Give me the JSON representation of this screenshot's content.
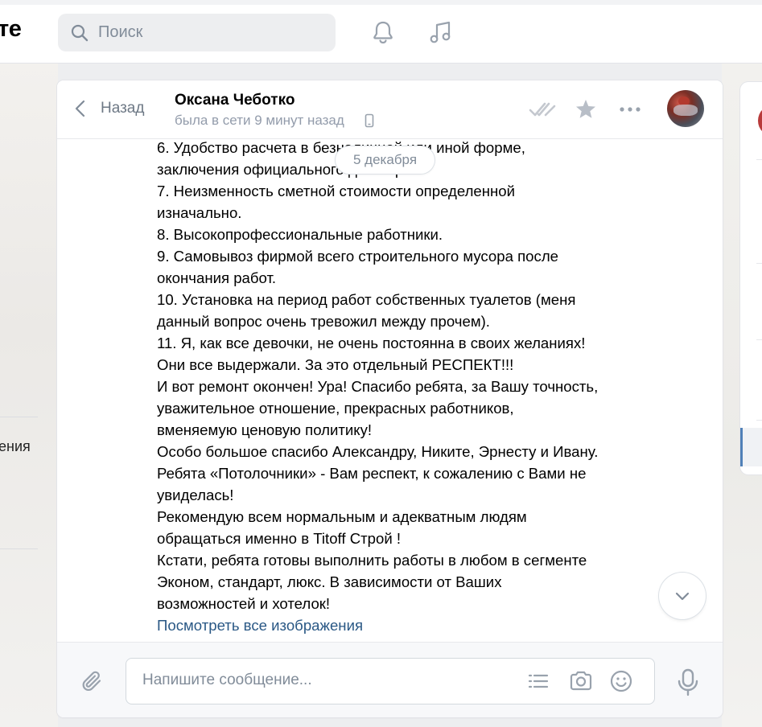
{
  "top": {
    "logo_fragment": "те",
    "search_placeholder": "Поиск"
  },
  "left": {
    "fragment": "ения"
  },
  "header": {
    "back_label": "Назад",
    "peer_name": "Оксана Чеботко",
    "peer_status": "была в сети 9 минут назад"
  },
  "date_pill": "5 декабря",
  "message": {
    "lines": [
      "6. Удобство расчета в безналичной или иной форме,",
      "заключения официального договора.",
      "7. Неизменность сметной стоимости определенной",
      "изначально.",
      "8. Высокопрофессиональные работники.",
      "9. Самовывоз фирмой всего строительного мусора после",
      "окончания работ.",
      "10. Установка на период работ собственных туалетов (меня",
      "данный вопрос очень тревожил между прочем).",
      "11. Я, как все девочки, не очень постоянна в своих желаниях!",
      "Они все выдержали. За это отдельный РЕСПЕКТ!!!",
      "И вот ремонт окончен! Ура! Спасибо ребята, за Вашу точность,",
      "уважительное отношение, прекрасных работников,",
      "вменяемую ценовую политику!",
      "Особо большое спасибо Александру, Никите, Эрнесту и Ивану.",
      "Ребята «Потолочники» - Вам респект, к сожалению с Вами не",
      "увиделась!",
      "Рекомендую всем нормальным и адекватным людям",
      "обращаться именно в Titoff Строй !",
      "Кстати, ребята готовы выполнить работы в любом в сегменте",
      "Эконом, стандарт, люкс. В зависимости от Ваших",
      "возможностей и хотелок!"
    ],
    "link": "Посмотреть все изображения"
  },
  "composer": {
    "placeholder": "Напишите сообщение..."
  },
  "icons": {
    "search": "search-icon",
    "bell": "bell-icon",
    "music": "music-icon",
    "back": "chevron-left-icon",
    "phone": "phone-icon",
    "read": "double-check-icon",
    "star": "star-icon",
    "more": "more-icon",
    "down": "chevron-down-icon",
    "attach": "paperclip-icon",
    "list": "list-icon",
    "camera": "camera-icon",
    "smile": "smile-icon",
    "mic": "microphone-icon"
  },
  "colors": {
    "link": "#2a5885",
    "muted": "#818c99",
    "icon": "#99a2ad",
    "accent": "#5181b8"
  }
}
